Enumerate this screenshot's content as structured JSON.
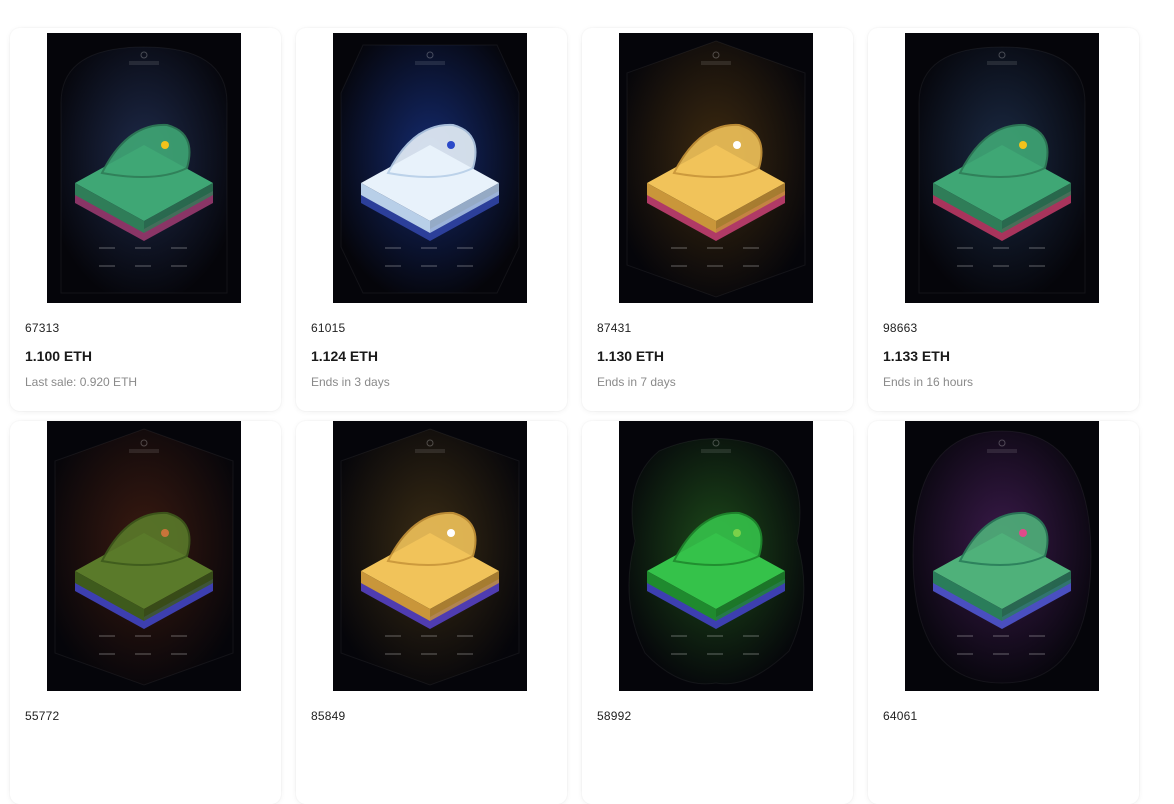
{
  "items": [
    {
      "id": "67313",
      "price": "1.100 ETH",
      "sub": "Last sale: 0.920 ETH",
      "art": {
        "glow": "#1e2a4a",
        "land": "#3fa775",
        "land2": "#2f7d58",
        "base": "#8a3566",
        "shape": "arch",
        "accent": "#f2c21b"
      }
    },
    {
      "id": "61015",
      "price": "1.124 ETH",
      "sub": "Ends in 3 days",
      "art": {
        "glow": "#142a6e",
        "land": "#e8f2fb",
        "land2": "#b8cfe8",
        "base": "#2c3f9a",
        "shape": "oct",
        "accent": "#2b49c8"
      }
    },
    {
      "id": "87431",
      "price": "1.130 ETH",
      "sub": "Ends in 7 days",
      "art": {
        "glow": "#3d2a10",
        "land": "#f1c35a",
        "land2": "#c9963a",
        "base": "#b03a66",
        "shape": "hex",
        "accent": "#ffffff"
      }
    },
    {
      "id": "98663",
      "price": "1.133 ETH",
      "sub": "Ends in 16 hours",
      "art": {
        "glow": "#1b2a44",
        "land": "#3fa775",
        "land2": "#2f7d58",
        "base": "#a8345c",
        "shape": "arch",
        "accent": "#f2c21b"
      }
    },
    {
      "id": "55772",
      "price": "",
      "sub": "",
      "art": {
        "glow": "#3a1a10",
        "land": "#5a7a2a",
        "land2": "#3e5a1c",
        "base": "#3d3fb0",
        "shape": "hex",
        "accent": "#c9743a"
      }
    },
    {
      "id": "85849",
      "price": "",
      "sub": "",
      "art": {
        "glow": "#3a2c14",
        "land": "#f1c35a",
        "land2": "#c9963a",
        "base": "#4f3cb0",
        "shape": "hex",
        "accent": "#ffffff"
      }
    },
    {
      "id": "58992",
      "price": "",
      "sub": "",
      "art": {
        "glow": "#1d4a1a",
        "land": "#35c24a",
        "land2": "#1f8a2e",
        "base": "#3d3fb0",
        "shape": "blob",
        "accent": "#7ad14a"
      }
    },
    {
      "id": "64061",
      "price": "",
      "sub": "",
      "art": {
        "glow": "#3a1a4a",
        "land": "#4fb17a",
        "land2": "#2a7d5a",
        "base": "#4a4fc0",
        "shape": "oval",
        "accent": "#e04a8a"
      }
    }
  ]
}
